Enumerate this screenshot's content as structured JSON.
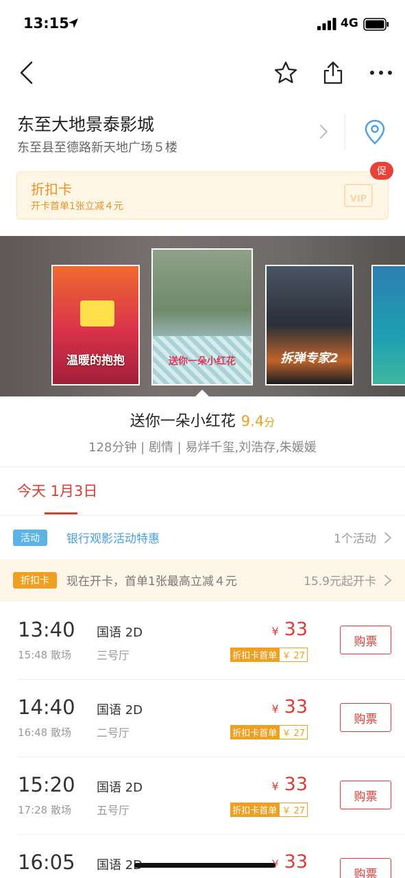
{
  "status_bar": {
    "time": "13:15",
    "network": "4G"
  },
  "cinema": {
    "name": "东至大地景泰影城",
    "address": "东至县至德路新天地广场５楼"
  },
  "discount_card": {
    "title": "折扣卡",
    "subtitle": "开卡首单1张立减４元",
    "vip_label": "VIP",
    "badge": "促"
  },
  "posters": [
    {
      "text": "温暖的抱抱",
      "bg": "#d8324a"
    },
    {
      "text": "送你一朵小红花",
      "bg": "#6f8a6a"
    },
    {
      "text": "拆弹专家2",
      "bg": "#2a2f38"
    },
    {
      "text": "",
      "bg": "#2d7fb0"
    }
  ],
  "movie": {
    "title": "送你一朵小红花",
    "score": "9.4",
    "score_unit": "分",
    "meta": "128分钟 | 剧情 | 易烊千玺,刘浩存,朱媛媛"
  },
  "date_tab": "今天 1月3日",
  "activity_row": {
    "tag": "活动",
    "text": "银行观影活动特惠",
    "right": "1个活动"
  },
  "card_row": {
    "tag": "折扣卡",
    "text": "现在开卡，首单1张最高立减４元",
    "right": "15.9元起开卡"
  },
  "showtimes": [
    {
      "start": "13:40",
      "end": "15:48 散场",
      "lang": "国语 2D",
      "hall": "三号厅",
      "currency": "¥",
      "price": "33",
      "card_label": "折扣卡首单",
      "card_price": "￥ 27",
      "buy": "购票"
    },
    {
      "start": "14:40",
      "end": "16:48 散场",
      "lang": "国语 2D",
      "hall": "二号厅",
      "currency": "¥",
      "price": "33",
      "card_label": "折扣卡首单",
      "card_price": "￥ 27",
      "buy": "购票"
    },
    {
      "start": "15:20",
      "end": "17:28 散场",
      "lang": "国语 2D",
      "hall": "五号厅",
      "currency": "¥",
      "price": "33",
      "card_label": "折扣卡首单",
      "card_price": "￥ 27",
      "buy": "购票"
    },
    {
      "start": "16:05",
      "end": "",
      "lang": "国语 2D",
      "hall": "",
      "currency": "¥",
      "price": "33",
      "card_label": "",
      "card_price": "",
      "buy": "购票"
    }
  ],
  "colors": {
    "accent": "#e23a33",
    "gold": "#f0a020",
    "activity_tag": "#5bb3e6"
  }
}
